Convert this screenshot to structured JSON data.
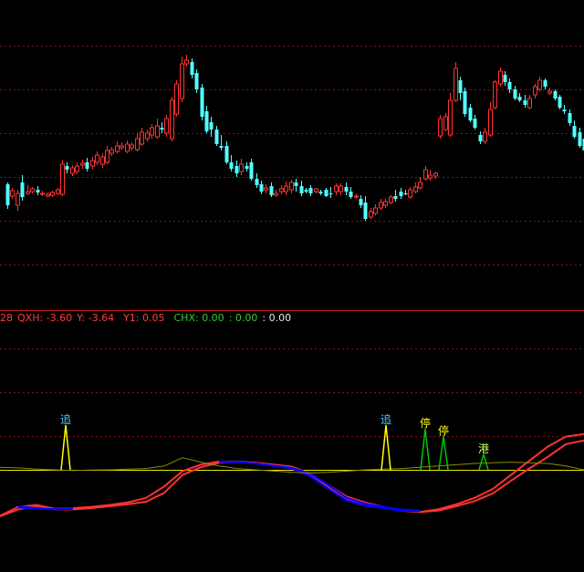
{
  "chart_data": [
    {
      "type": "candlestick",
      "colors": {
        "up": "#ff3232",
        "down": "#54ffff",
        "grid": "#8a1414",
        "divider": "#c81818"
      },
      "bars": [
        [
          202,
          225,
          200,
          229
        ],
        [
          215,
          209,
          206,
          218
        ],
        [
          225,
          212,
          208,
          231
        ],
        [
          200,
          216,
          192,
          220
        ],
        [
          212,
          210,
          203,
          214
        ],
        [
          210,
          207,
          205,
          212
        ],
        [
          208,
          211,
          204,
          214
        ],
        [
          213,
          212,
          209,
          215
        ],
        [
          215,
          213,
          211,
          216
        ],
        [
          214,
          211,
          209,
          216
        ],
        [
          212,
          208,
          206,
          214
        ],
        [
          213,
          180,
          176,
          215
        ],
        [
          182,
          186,
          178,
          190
        ],
        [
          190,
          184,
          181,
          193
        ],
        [
          188,
          182,
          178,
          191
        ],
        [
          181,
          179,
          175,
          185
        ],
        [
          178,
          185,
          173,
          188
        ],
        [
          182,
          176,
          172,
          186
        ],
        [
          178,
          170,
          166,
          181
        ],
        [
          180,
          172,
          168,
          184
        ],
        [
          178,
          165,
          160,
          180
        ],
        [
          168,
          164,
          161,
          171
        ],
        [
          166,
          160,
          155,
          168
        ],
        [
          162,
          160,
          156,
          164
        ],
        [
          166,
          158,
          154,
          168
        ],
        [
          162,
          159,
          156,
          165
        ],
        [
          164,
          152,
          146,
          166
        ],
        [
          158,
          145,
          140,
          160
        ],
        [
          152,
          146,
          142,
          155
        ],
        [
          148,
          140,
          136,
          152
        ],
        [
          150,
          138,
          130,
          152
        ],
        [
          140,
          142,
          134,
          146
        ],
        [
          146,
          130,
          126,
          150
        ],
        [
          152,
          110,
          106,
          155
        ],
        [
          125,
          92,
          88,
          128
        ],
        [
          108,
          70,
          62,
          112
        ],
        [
          70,
          66,
          60,
          73
        ],
        [
          68,
          82,
          64,
          86
        ],
        [
          80,
          98,
          76,
          102
        ],
        [
          96,
          128,
          92,
          132
        ],
        [
          122,
          144,
          116,
          146
        ],
        [
          134,
          142,
          128,
          150
        ],
        [
          142,
          158,
          138,
          160
        ],
        [
          160,
          162,
          148,
          165
        ],
        [
          160,
          178,
          155,
          180
        ],
        [
          178,
          185,
          170,
          188
        ],
        [
          182,
          190,
          176,
          194
        ],
        [
          188,
          180,
          174,
          192
        ],
        [
          182,
          185,
          178,
          188
        ],
        [
          178,
          196,
          174,
          198
        ],
        [
          196,
          203,
          190,
          206
        ],
        [
          202,
          210,
          198,
          213
        ],
        [
          208,
          206,
          202,
          212
        ],
        [
          204,
          214,
          200,
          216
        ],
        [
          214,
          212,
          208,
          216
        ],
        [
          210,
          207,
          203,
          213
        ],
        [
          210,
          204,
          199,
          214
        ],
        [
          208,
          200,
          197,
          212
        ],
        [
          200,
          204,
          196,
          210
        ],
        [
          204,
          212,
          198,
          215
        ],
        [
          208,
          210,
          206,
          212
        ],
        [
          206,
          212,
          203,
          215
        ],
        [
          210,
          207,
          206,
          212
        ],
        [
          210,
          212,
          208,
          214
        ],
        [
          208,
          215,
          206,
          216
        ],
        [
          212,
          213,
          205,
          217
        ],
        [
          210,
          204,
          201,
          214
        ],
        [
          210,
          204,
          201,
          214
        ],
        [
          205,
          210,
          200,
          214
        ],
        [
          210,
          216,
          205,
          218
        ],
        [
          216,
          215,
          212,
          218
        ],
        [
          218,
          225,
          214,
          228
        ],
        [
          222,
          240,
          215,
          242
        ],
        [
          238,
          232,
          228,
          240
        ],
        [
          234,
          228,
          224,
          236
        ],
        [
          228,
          222,
          218,
          230
        ],
        [
          225,
          221,
          218,
          228
        ],
        [
          222,
          216,
          214,
          224
        ],
        [
          215,
          218,
          208,
          221
        ],
        [
          210,
          215,
          206,
          218
        ],
        [
          212,
          212,
          208,
          214
        ],
        [
          216,
          208,
          205,
          218
        ],
        [
          210,
          205,
          200,
          212
        ],
        [
          206,
          200,
          194,
          208
        ],
        [
          196,
          186,
          182,
          198
        ],
        [
          195,
          192,
          186,
          198
        ],
        [
          193,
          190,
          188,
          196
        ],
        [
          149,
          130,
          126,
          152
        ],
        [
          142,
          128,
          124,
          144
        ],
        [
          148,
          110,
          102,
          150
        ],
        [
          110,
          75,
          68,
          112
        ],
        [
          88,
          102,
          84,
          110
        ],
        [
          100,
          125,
          96,
          128
        ],
        [
          118,
          132,
          114,
          134
        ],
        [
          130,
          140,
          126,
          142
        ],
        [
          148,
          155,
          144,
          158
        ],
        [
          155,
          145,
          140,
          158
        ],
        [
          148,
          120,
          112,
          150
        ],
        [
          118,
          90,
          88,
          120
        ],
        [
          92,
          78,
          74,
          95
        ],
        [
          82,
          90,
          78,
          94
        ],
        [
          90,
          98,
          86,
          102
        ],
        [
          98,
          108,
          94,
          110
        ],
        [
          106,
          110,
          102,
          112
        ],
        [
          110,
          115,
          104,
          118
        ],
        [
          118,
          108,
          104,
          120
        ],
        [
          104,
          95,
          92,
          108
        ],
        [
          98,
          88,
          84,
          100
        ],
        [
          88,
          95,
          86,
          98
        ],
        [
          102,
          100,
          96,
          104
        ],
        [
          100,
          108,
          98,
          110
        ],
        [
          106,
          118,
          104,
          120
        ],
        [
          120,
          122,
          115,
          125
        ],
        [
          124,
          135,
          120,
          138
        ],
        [
          138,
          150,
          132,
          152
        ],
        [
          145,
          160,
          140,
          162
        ],
        [
          152,
          165,
          148,
          168
        ]
      ]
    },
    {
      "type": "line",
      "legend": [
        {
          "text": "28",
          "color": "#ff3c3c"
        },
        {
          "text": "QXH: -3.60",
          "color": "#ff3c3c"
        },
        {
          "text": "Y: -3.64",
          "color": "#ff3c3c"
        },
        {
          "text": "Y1: 0.05",
          "color": "#ff3c3c"
        },
        {
          "text": "CHX: 0.00",
          "color": "#32c832"
        },
        {
          "text": ": 0.00",
          "color": "#32c832"
        },
        {
          "text": ": 0.00",
          "color": "#e8e8e8"
        }
      ],
      "zero_line": 0.0,
      "colors": {
        "zero_line": "#e6e600",
        "olive": "#8c8c00"
      },
      "x": [
        0,
        20,
        40,
        60,
        80,
        100,
        120,
        140,
        160,
        180,
        200,
        220,
        240,
        260,
        280,
        300,
        320,
        340,
        360,
        380,
        400,
        420,
        440,
        460,
        480,
        500,
        520,
        540,
        560,
        580,
        600,
        620,
        640
      ],
      "series": [
        {
          "color": "#ff3232",
          "values": [
            -3.6,
            -2.9,
            -2.75,
            -3.05,
            -3.0,
            -2.9,
            -2.75,
            -2.55,
            -2.2,
            -1.3,
            -0.1,
            0.4,
            0.65,
            0.65,
            0.55,
            0.4,
            0.2,
            -0.4,
            -1.4,
            -2.3,
            -2.7,
            -2.95,
            -3.2,
            -3.3,
            -3.1,
            -2.7,
            -2.2,
            -1.5,
            -0.4,
            0.7,
            1.8,
            2.6,
            2.8
          ]
        },
        {
          "color": "#ff3232",
          "values": [
            -3.64,
            -3.1,
            -2.85,
            -3.1,
            -3.1,
            -3.0,
            -2.85,
            -2.7,
            -2.5,
            -1.8,
            -0.4,
            0.2,
            0.55,
            0.62,
            0.55,
            0.4,
            0.25,
            -0.3,
            -1.2,
            -2.1,
            -2.55,
            -2.9,
            -3.2,
            -3.3,
            -3.2,
            -2.85,
            -2.45,
            -1.85,
            -0.85,
            0.1,
            1.0,
            2.0,
            2.3
          ]
        },
        {
          "color": "#0000ff",
          "values": [
            null,
            -2.85,
            -3.0,
            -3.1,
            -3.0,
            null,
            null,
            null,
            null,
            null,
            null,
            null,
            0.65,
            0.62,
            0.5,
            0.3,
            0.1,
            -0.5,
            -1.5,
            -2.4,
            -2.8,
            -3.0,
            -3.2,
            -3.25,
            null,
            null,
            null,
            null,
            null,
            null,
            null,
            null,
            null
          ]
        },
        {
          "color": "#0000ff",
          "values": [
            null,
            -2.95,
            -3.05,
            -3.1,
            -3.05,
            null,
            null,
            null,
            null,
            null,
            null,
            null,
            0.6,
            0.6,
            0.5,
            0.32,
            0.15,
            -0.3,
            -1.2,
            -2.2,
            -2.65,
            -2.9,
            -3.1,
            -3.2,
            null,
            null,
            null,
            null,
            null,
            null,
            null,
            null,
            null
          ]
        },
        {
          "color": "#8c8c00",
          "values": [
            0.2,
            0.15,
            0.05,
            0.0,
            -0.05,
            -0.02,
            0.0,
            0.05,
            0.1,
            0.3,
            0.95,
            0.6,
            0.3,
            0.1,
            0.0,
            -0.1,
            -0.2,
            -0.25,
            -0.2,
            -0.1,
            0.0,
            0.05,
            0.1,
            0.2,
            0.3,
            0.4,
            0.5,
            0.55,
            0.6,
            0.55,
            0.5,
            0.3,
            0.0
          ]
        }
      ],
      "signals": [
        {
          "label": "追",
          "x": 72,
          "height": 3.5,
          "color": "#ffff00",
          "label_color": "#4fd0ff"
        },
        {
          "label": "追",
          "x": 423,
          "height": 3.5,
          "color": "#ffff00",
          "label_color": "#4fd0ff"
        },
        {
          "label": "停",
          "x": 466,
          "height": 3.2,
          "color": "#00c800",
          "label_color": "#ffff00"
        },
        {
          "label": "停",
          "x": 486,
          "height": 2.6,
          "color": "#00c800",
          "label_color": "#ffff00"
        },
        {
          "label": "港",
          "x": 530,
          "height": 1.2,
          "color": "#00c800",
          "label_color": "#c8ff64"
        }
      ]
    }
  ]
}
